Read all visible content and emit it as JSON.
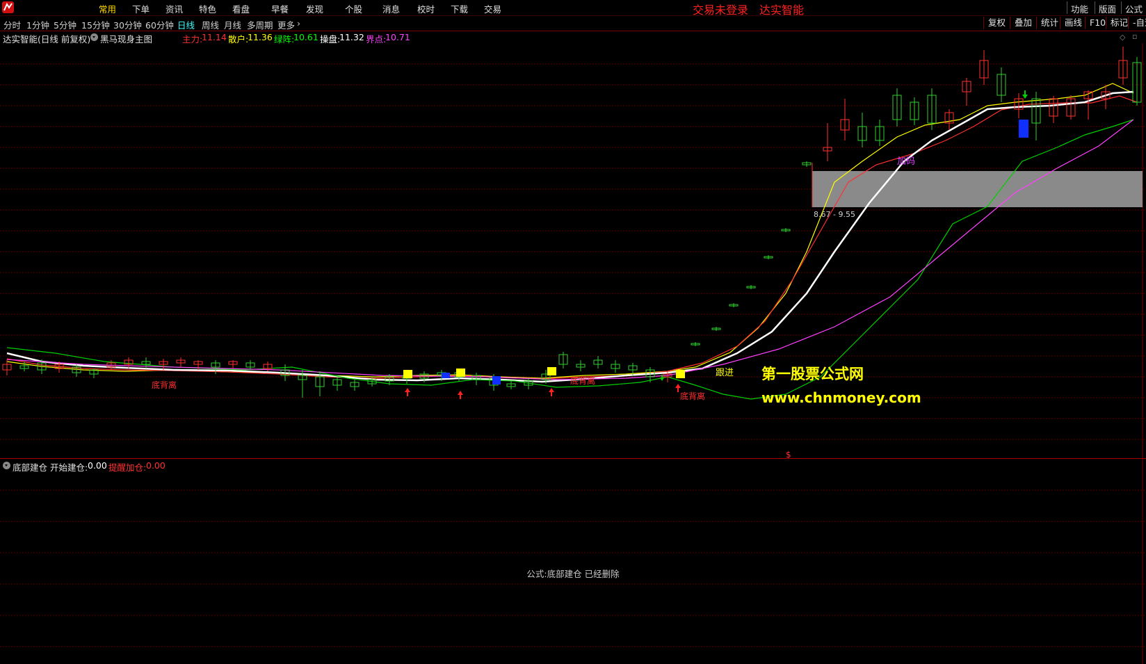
{
  "menubar": {
    "items": [
      "常用",
      "下单",
      "资讯",
      "特色",
      "看盘",
      "早餐",
      "发现",
      "个股",
      "消息",
      "校时",
      "下载",
      "交易"
    ],
    "active_index": 0,
    "login_notice": "交易未登录",
    "brand": "达实智能",
    "right_buttons": [
      "功能",
      "版面",
      "公式"
    ]
  },
  "periodbar": {
    "periods": [
      "分时",
      "1分钟",
      "5分钟",
      "15分钟",
      "30分钟",
      "60分钟",
      "日线",
      "周线",
      "月线",
      "多周期",
      "更多"
    ],
    "active_index": 6,
    "tools": [
      "复权",
      "叠加",
      "统计",
      "画线",
      "F10",
      "标记",
      "-自适"
    ]
  },
  "main_info": {
    "stock_title": "达实智能(日线 前复权)",
    "formula_name": "黑马现身主图",
    "indicators": [
      {
        "label": "主力:",
        "value": "11.14",
        "color": "#ff3030"
      },
      {
        "label": "散户:",
        "value": "11.36",
        "color": "#ffff00"
      },
      {
        "label": "绿阵:",
        "value": "10.61",
        "color": "#00ff00"
      },
      {
        "label": "操盘:",
        "value": "11.32",
        "color": "#ffffff"
      },
      {
        "label": "界点:",
        "value": "10.71",
        "color": "#ff40ff"
      }
    ]
  },
  "chart_labels": {
    "zone_range": "8.67 - 9.55",
    "jiama": "加码",
    "genjin": "跟进",
    "dibu1": "底背离",
    "dibu2": "底背离",
    "dibu3": "底背离",
    "price_marker": "$"
  },
  "sub_info": {
    "formula_name": "底部建仓",
    "fields": [
      {
        "label": "开始建仓:",
        "value": "0.00",
        "color": "#ffffff"
      },
      {
        "label": "提醒加仓:",
        "value": "0.00",
        "color": "#ff3030"
      }
    ],
    "message": "公式:底部建仓 已经删除"
  },
  "watermark": {
    "title": "第一股票公式网",
    "url": "www.chnmoney.com"
  },
  "colors": {
    "background": "#000000",
    "grid": "#5a0000",
    "up_candle": "#ff3030",
    "down_candle": "#30d030",
    "main_line": "#ffffff",
    "retail_line": "#ffff00",
    "green_line": "#00d000",
    "magenta_line": "#ff40ff",
    "zone": "#8a8a8a"
  }
}
